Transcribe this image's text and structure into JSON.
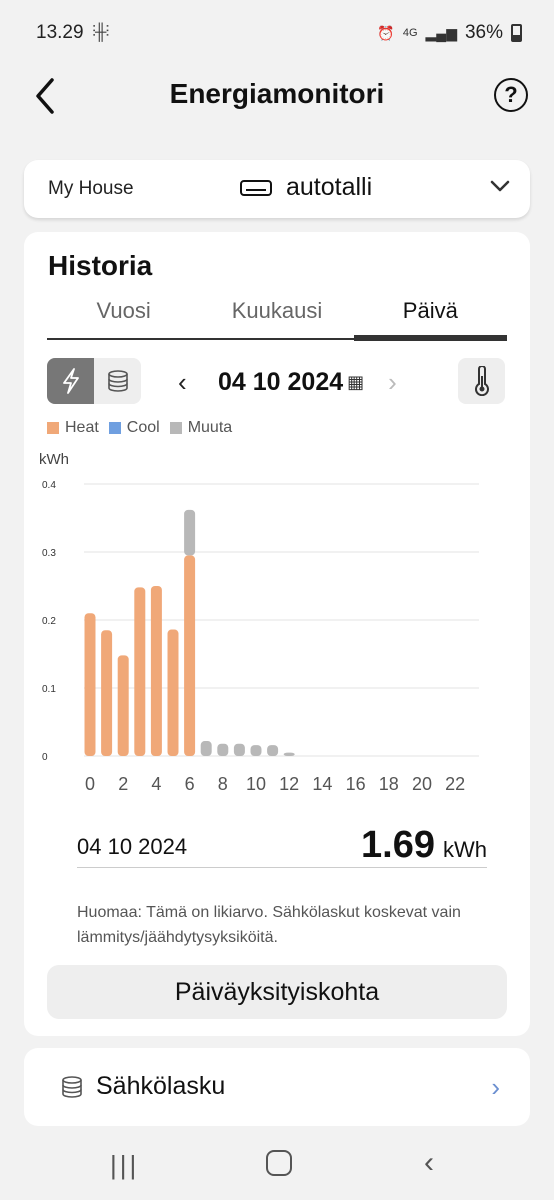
{
  "status_bar": {
    "time": "13.29",
    "battery": "36%",
    "network": "4G"
  },
  "header": {
    "title": "Energiamonitori"
  },
  "house": {
    "name": "My House",
    "device": "autotalli"
  },
  "history": {
    "title": "Historia",
    "tabs": [
      {
        "label": "Vuosi",
        "active": false
      },
      {
        "label": "Kuukausi",
        "active": false
      },
      {
        "label": "Päivä",
        "active": true
      }
    ],
    "date": "04 10 2024",
    "summary_date": "04 10 2024",
    "total": "1.69",
    "unit": "kWh",
    "note": "Huomaa: Tämä on likiarvo. Sähkölaskut koskevat vain lämmitys/jäähdytysyksiköitä.",
    "detail_button": "Päiväyksityiskohta"
  },
  "bill": {
    "label": "Sähkölasku"
  },
  "chart_data": {
    "type": "bar",
    "stacked": true,
    "ylabel": "kWh",
    "ylim": [
      0,
      0.4
    ],
    "yticks": [
      0,
      0.1,
      0.2,
      0.3,
      0.4
    ],
    "ytick_labels": [
      "0",
      "0.1",
      "0.2",
      "0.3",
      "0.4"
    ],
    "categories": [
      0,
      1,
      2,
      3,
      4,
      5,
      6,
      7,
      8,
      9,
      10,
      11,
      12,
      13,
      14,
      15,
      16,
      17,
      18,
      19,
      20,
      21,
      22,
      23
    ],
    "xtick_labels": [
      "0",
      "2",
      "4",
      "6",
      "8",
      "10",
      "12",
      "14",
      "16",
      "18",
      "20",
      "22"
    ],
    "colors": {
      "Heat": "#f0a878",
      "Cool": "#6f9fe0",
      "Muuta": "#b8b8b8"
    },
    "series": [
      {
        "name": "Heat",
        "values": [
          0.21,
          0.185,
          0.148,
          0.248,
          0.25,
          0.186,
          0.295,
          0,
          0,
          0,
          0,
          0,
          0,
          0,
          0,
          0,
          0,
          0,
          0,
          0,
          0,
          0,
          0,
          0
        ]
      },
      {
        "name": "Cool",
        "values": [
          0,
          0,
          0,
          0,
          0,
          0,
          0,
          0,
          0,
          0,
          0,
          0,
          0,
          0,
          0,
          0,
          0,
          0,
          0,
          0,
          0,
          0,
          0,
          0
        ]
      },
      {
        "name": "Muuta",
        "values": [
          0,
          0,
          0,
          0,
          0,
          0,
          0.067,
          0.022,
          0.018,
          0.018,
          0.016,
          0.016,
          0.005,
          0,
          0,
          0,
          0,
          0,
          0,
          0,
          0,
          0,
          0,
          0
        ]
      }
    ],
    "grid": true,
    "legend": "top-left"
  }
}
